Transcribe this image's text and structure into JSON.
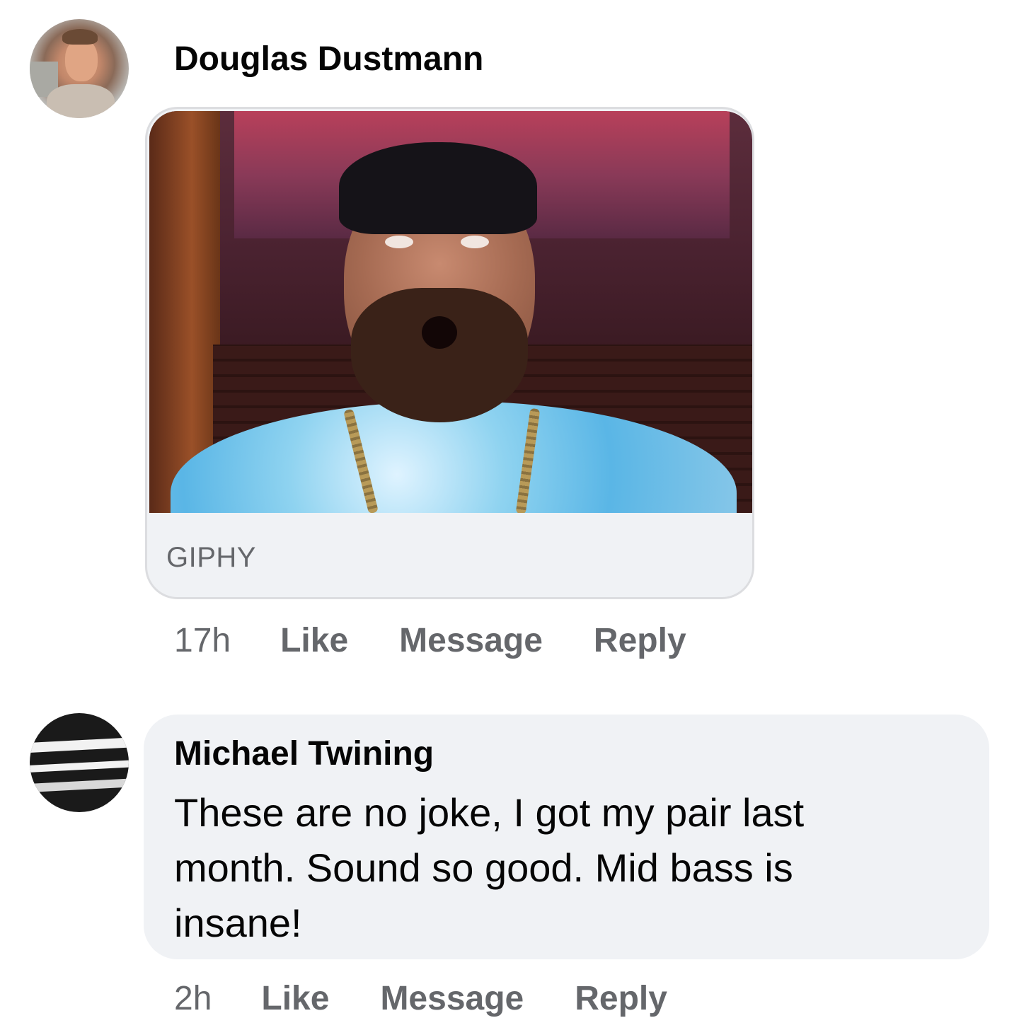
{
  "comments": [
    {
      "author": "Douglas Dustmann",
      "attachment": {
        "type": "gif",
        "source_label": "GIPHY"
      },
      "time": "17h",
      "actions": {
        "like": "Like",
        "message": "Message",
        "reply": "Reply"
      }
    },
    {
      "author": "Michael Twining",
      "text": "These are no joke, I got my pair last month. Sound so good. Mid bass is insane!",
      "time": "2h",
      "actions": {
        "like": "Like",
        "message": "Message",
        "reply": "Reply"
      }
    }
  ],
  "colors": {
    "text_primary": "#050505",
    "text_secondary": "#65676b",
    "bubble_background": "#f0f2f5",
    "card_border": "#dcdde0"
  }
}
